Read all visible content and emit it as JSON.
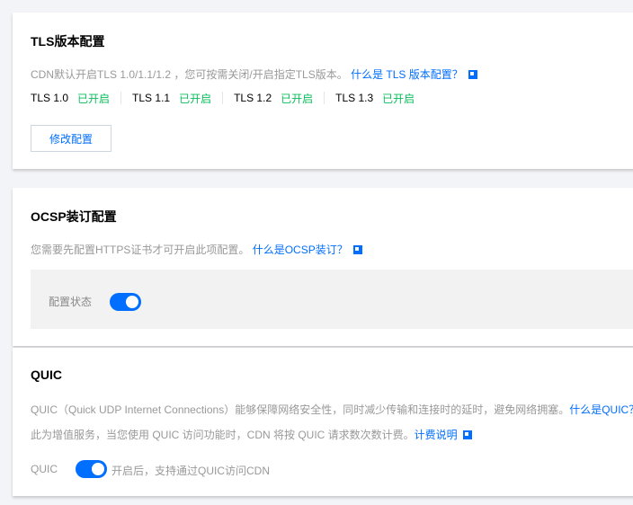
{
  "tls": {
    "title": "TLS版本配置",
    "desc": "CDN默认开启TLS 1.0/1.1/1.2 ，您可按需关闭/开启指定TLS版本。",
    "link": "什么是 TLS 版本配置？",
    "versions": [
      {
        "name": "TLS 1.0",
        "status": "已开启"
      },
      {
        "name": "TLS 1.1",
        "status": "已开启"
      },
      {
        "name": "TLS 1.2",
        "status": "已开启"
      },
      {
        "name": "TLS 1.3",
        "status": "已开启"
      }
    ],
    "button": "修改配置"
  },
  "ocsp": {
    "title": "OCSP装订配置",
    "desc": "您需要先配置HTTPS证书才可开启此项配置。",
    "link": "什么是OCSP装订？",
    "label": "配置状态",
    "enabled": true
  },
  "quic": {
    "title": "QUIC",
    "desc1": "QUIC（Quick UDP Internet Connections）能够保障网络安全性，同时减少传输和连接时的延时，避免网络拥塞。",
    "link1": "什么是QUIC？",
    "desc2": "此为增值服务，当您使用 QUIC 访问功能时，CDN 将按 QUIC 请求数次数计费。",
    "link2": "计费说明",
    "label": "QUIC",
    "enabled": true,
    "hint": "开启后，支持通过QUIC访问CDN"
  },
  "colors": {
    "accent": "#006eff",
    "success": "#0abf5b"
  }
}
